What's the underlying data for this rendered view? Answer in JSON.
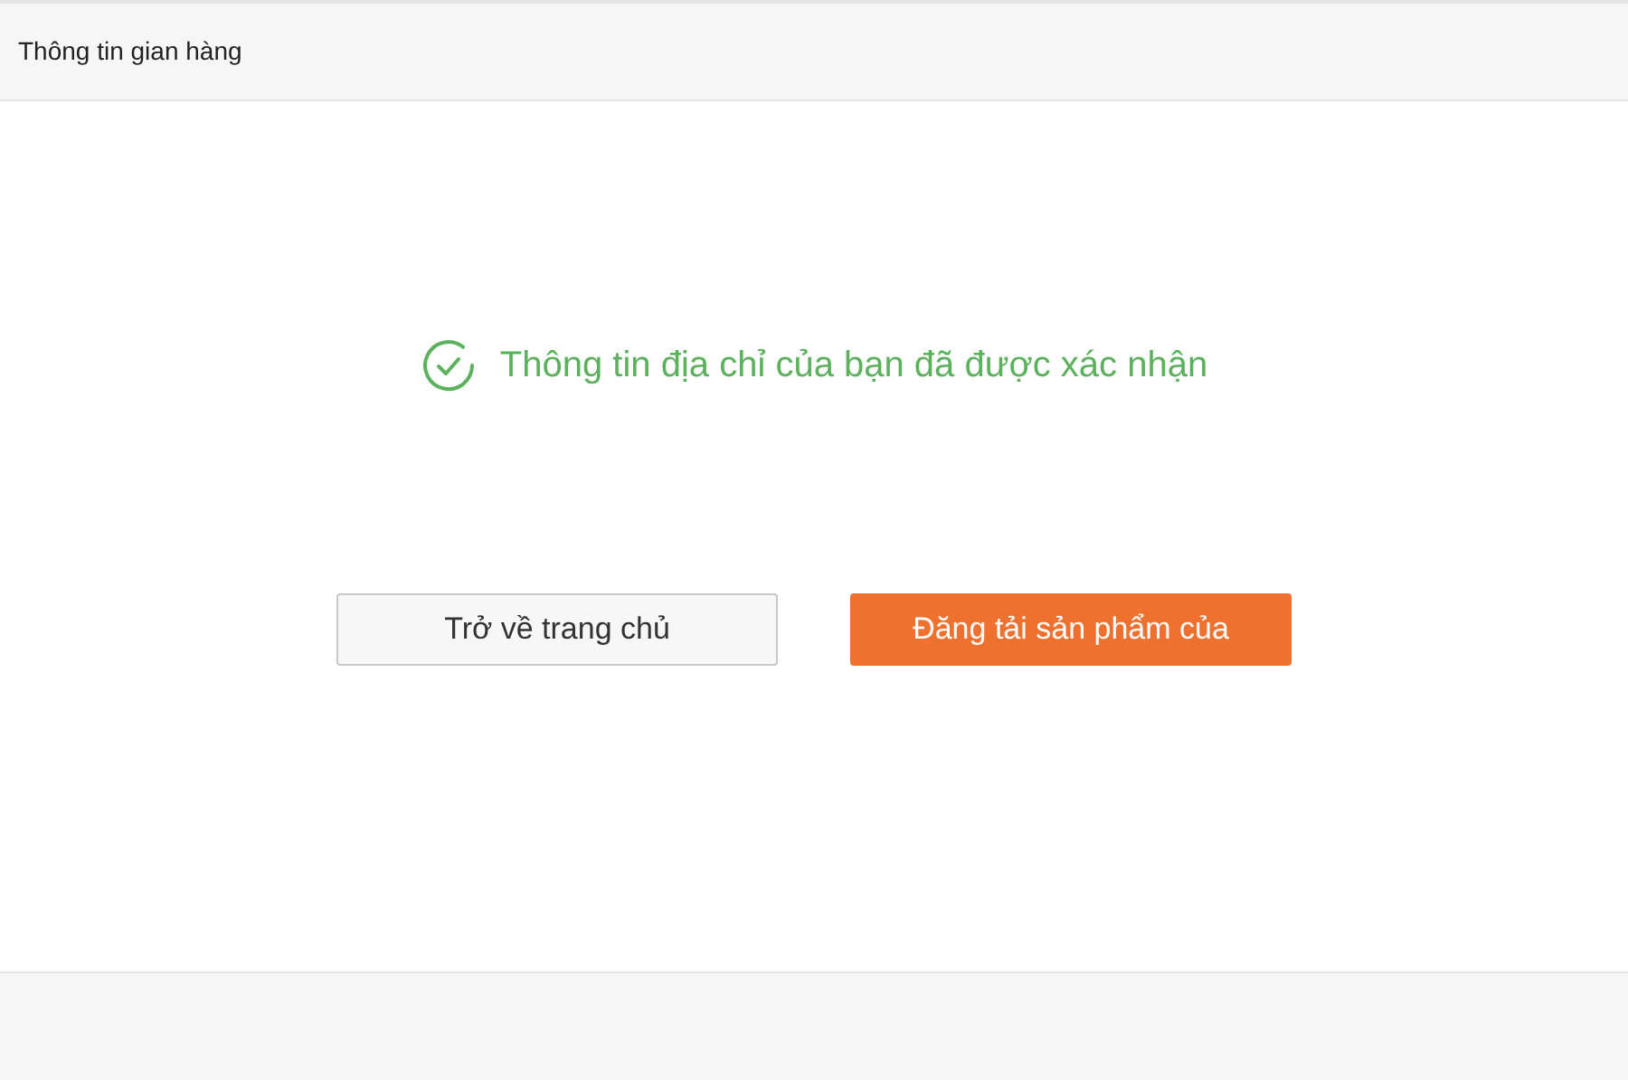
{
  "header": {
    "title": "Thông tin gian hàng"
  },
  "message": {
    "text": "Thông tin địa chỉ của bạn đã được xác nhận"
  },
  "buttons": [
    {
      "label": "Trở về trang chủ",
      "kind": "secondary"
    },
    {
      "label": "Đăng tải sản phẩm của",
      "kind": "primary"
    }
  ]
}
